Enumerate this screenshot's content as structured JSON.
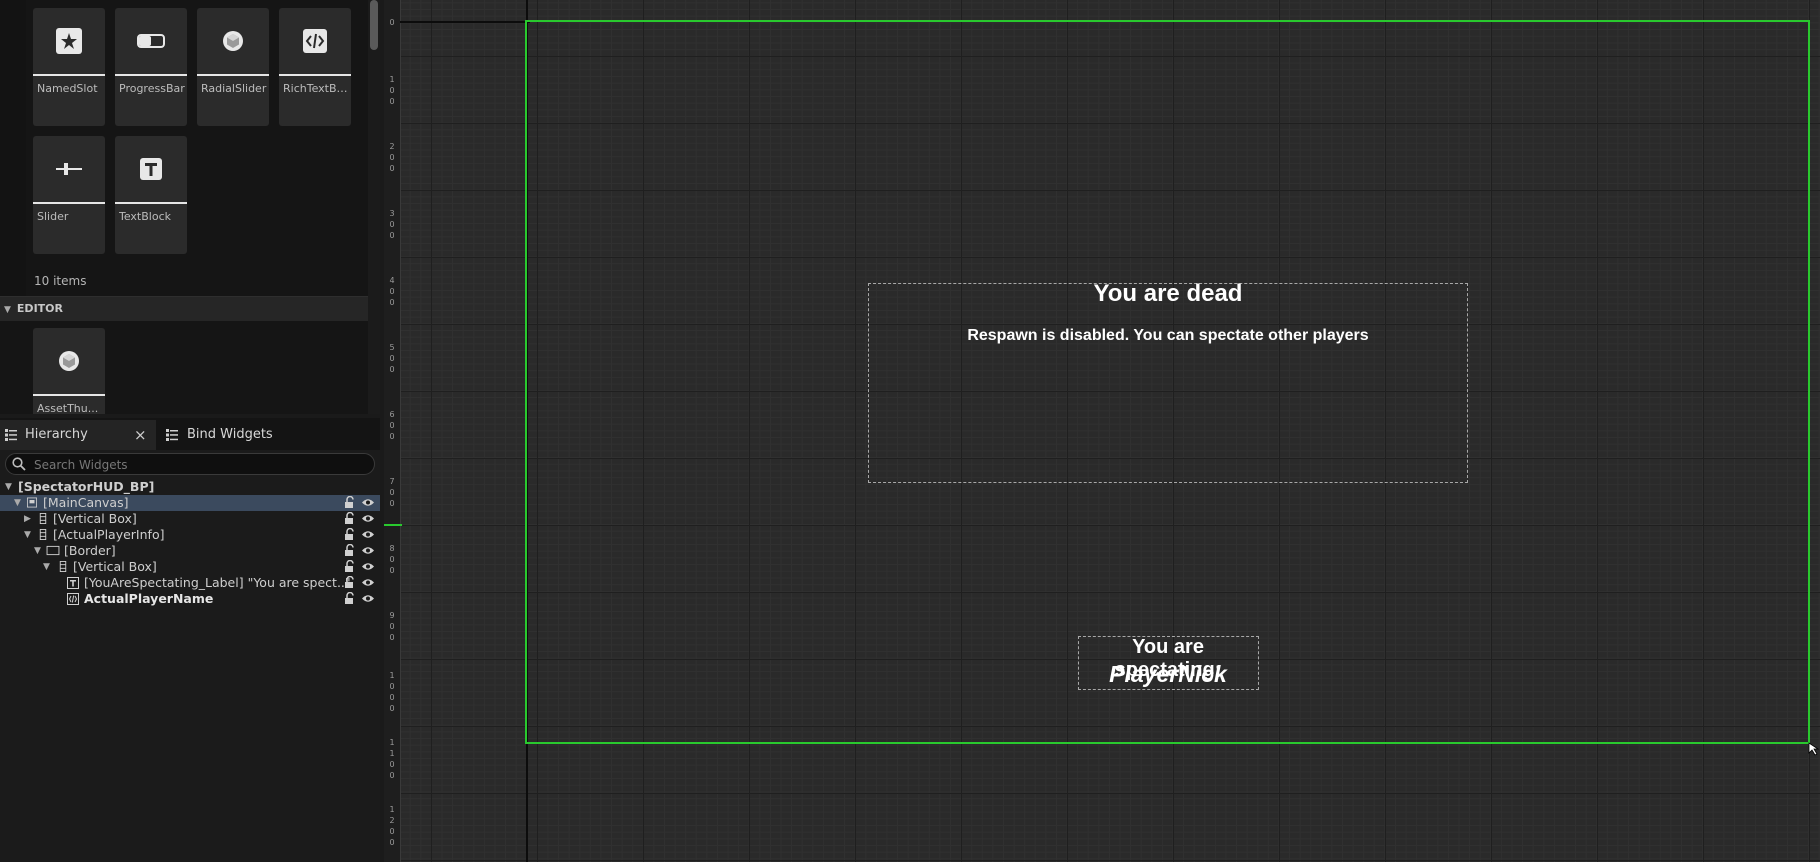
{
  "palette": {
    "tiles": [
      {
        "label": "NamedSlot",
        "icon": "named-slot-icon"
      },
      {
        "label": "ProgressBar",
        "icon": "progress-bar-icon"
      },
      {
        "label": "RadialSlider",
        "icon": "radial-slider-icon"
      },
      {
        "label": "RichTextBlo...",
        "icon": "rich-text-block-icon"
      },
      {
        "label": "Slider",
        "icon": "slider-icon"
      },
      {
        "label": "TextBlock",
        "icon": "text-block-icon"
      }
    ],
    "items_count": "10 items",
    "editor_section": {
      "title": "EDITOR",
      "tiles": [
        {
          "label": "AssetThu...",
          "icon": "asset-thumbnail-icon"
        }
      ]
    }
  },
  "tabs": {
    "hierarchy": "Hierarchy",
    "close": "×",
    "bind_widgets": "Bind Widgets"
  },
  "hierarchy": {
    "search_placeholder": "Search Widgets",
    "rows": [
      {
        "text": "[SpectatorHUD_BP]"
      },
      {
        "text": "[MainCanvas]"
      },
      {
        "text": "[Vertical Box]"
      },
      {
        "text": "[ActualPlayerInfo]"
      },
      {
        "text": "[Border]"
      },
      {
        "text": "[Vertical Box]"
      },
      {
        "text": "[YouAreSpectating_Label] \"You are spect..\""
      },
      {
        "text": "ActualPlayerName"
      }
    ]
  },
  "ruler": {
    "labels": [
      "0",
      "1\n0\n0",
      "2\n0\n0",
      "3\n0\n0",
      "4\n0\n0",
      "5\n0\n0",
      "6\n0\n0",
      "7\n0\n0",
      "8\n0\n0",
      "9\n0\n0",
      "1\n0\n0\n0",
      "1\n1\n0\n0",
      "1\n2\n0\n0"
    ]
  },
  "canvas": {
    "dead_title": "You are dead",
    "dead_subtitle": "Respawn is disabled. You can spectate other players",
    "spectating_label": "You are spectating:",
    "player_name": "PlayerNick"
  },
  "colors": {
    "canvas_border": "#29c92e",
    "selection": "#3b4a5e",
    "grid_bg": "#2a2a2a"
  }
}
